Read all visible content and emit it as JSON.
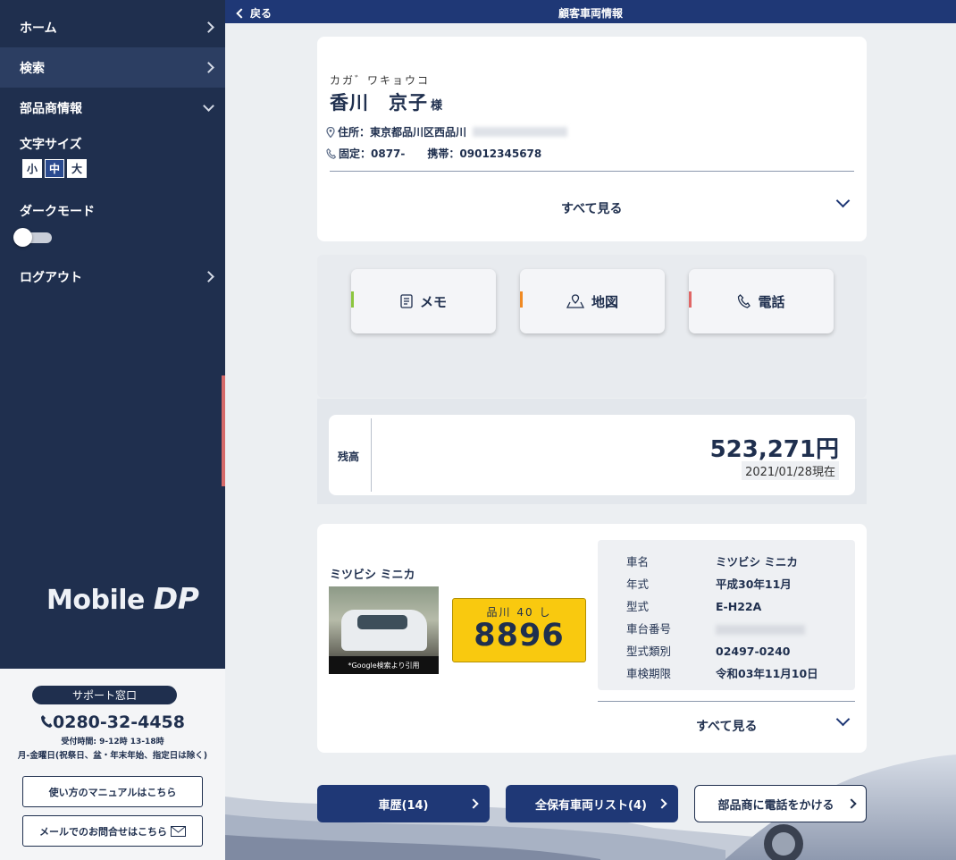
{
  "header": {
    "back_label": "戻る",
    "title": "顧客車両情報"
  },
  "sidebar": {
    "nav": [
      {
        "label": "ホーム"
      },
      {
        "label": "検索"
      },
      {
        "label": "部品商情報"
      }
    ],
    "font_size": {
      "label": "文字サイズ",
      "options": [
        "小",
        "中",
        "大"
      ],
      "selected": "中"
    },
    "dark_mode": {
      "label": "ダークモード",
      "on": false
    },
    "logout": {
      "label": "ログアウト"
    },
    "logo": {
      "part1": "Mobile ",
      "part2": "DP"
    }
  },
  "support": {
    "badge": "サポート窓口",
    "tel": "0280-32-4458",
    "hours": "受付時間:  9-12時 13-18時",
    "days": "月-金曜日(祝祭日、盆・年末年始、指定日は除く)",
    "manual_button": "使い方のマニュアルはこちら",
    "mail_button": "メールでのお問合せはこちら"
  },
  "customer": {
    "kana": "カガ゛ワキョウコ",
    "name": "香川　京子",
    "honorific": "様",
    "address_label": "住所：東京都品川区西品川",
    "phone_fixed": "固定：0877-",
    "phone_mobile": "携帯：09012345678",
    "see_all": "すべて見る"
  },
  "actions": [
    {
      "label": "メモ",
      "icon": "memo-icon",
      "accent": "#8cc63f"
    },
    {
      "label": "地図",
      "icon": "map-icon",
      "accent": "#f08a24"
    },
    {
      "label": "電話",
      "icon": "phone-icon",
      "accent": "#e06666"
    }
  ],
  "balance": {
    "label": "残高",
    "amount": "523,271円",
    "as_of": "2021/01/28現在"
  },
  "vehicle": {
    "title": "ミツビシ ミニカ",
    "image_caption": "*Google検索より引用",
    "plate": {
      "region": "品川 40 し",
      "number": "8896"
    },
    "specs": [
      {
        "key": "車名",
        "value": "ミツビシ ミニカ"
      },
      {
        "key": "年式",
        "value": "平成30年11月"
      },
      {
        "key": "型式",
        "value": "E-H22A"
      },
      {
        "key": "車台番号",
        "value": ""
      },
      {
        "key": "型式類別",
        "value": "02497-0240"
      },
      {
        "key": "車検期限",
        "value": "令和03年11月10日"
      }
    ],
    "see_all": "すべて見る"
  },
  "bottom_buttons": {
    "history": "車歴(14)",
    "vehicle_list": "全保有車両リスト(4)",
    "call_parts": "部品商に電話をかける"
  },
  "colors": {
    "navy": "#1f2f4e",
    "header": "#1f3876",
    "plate": "#f9c90f"
  }
}
